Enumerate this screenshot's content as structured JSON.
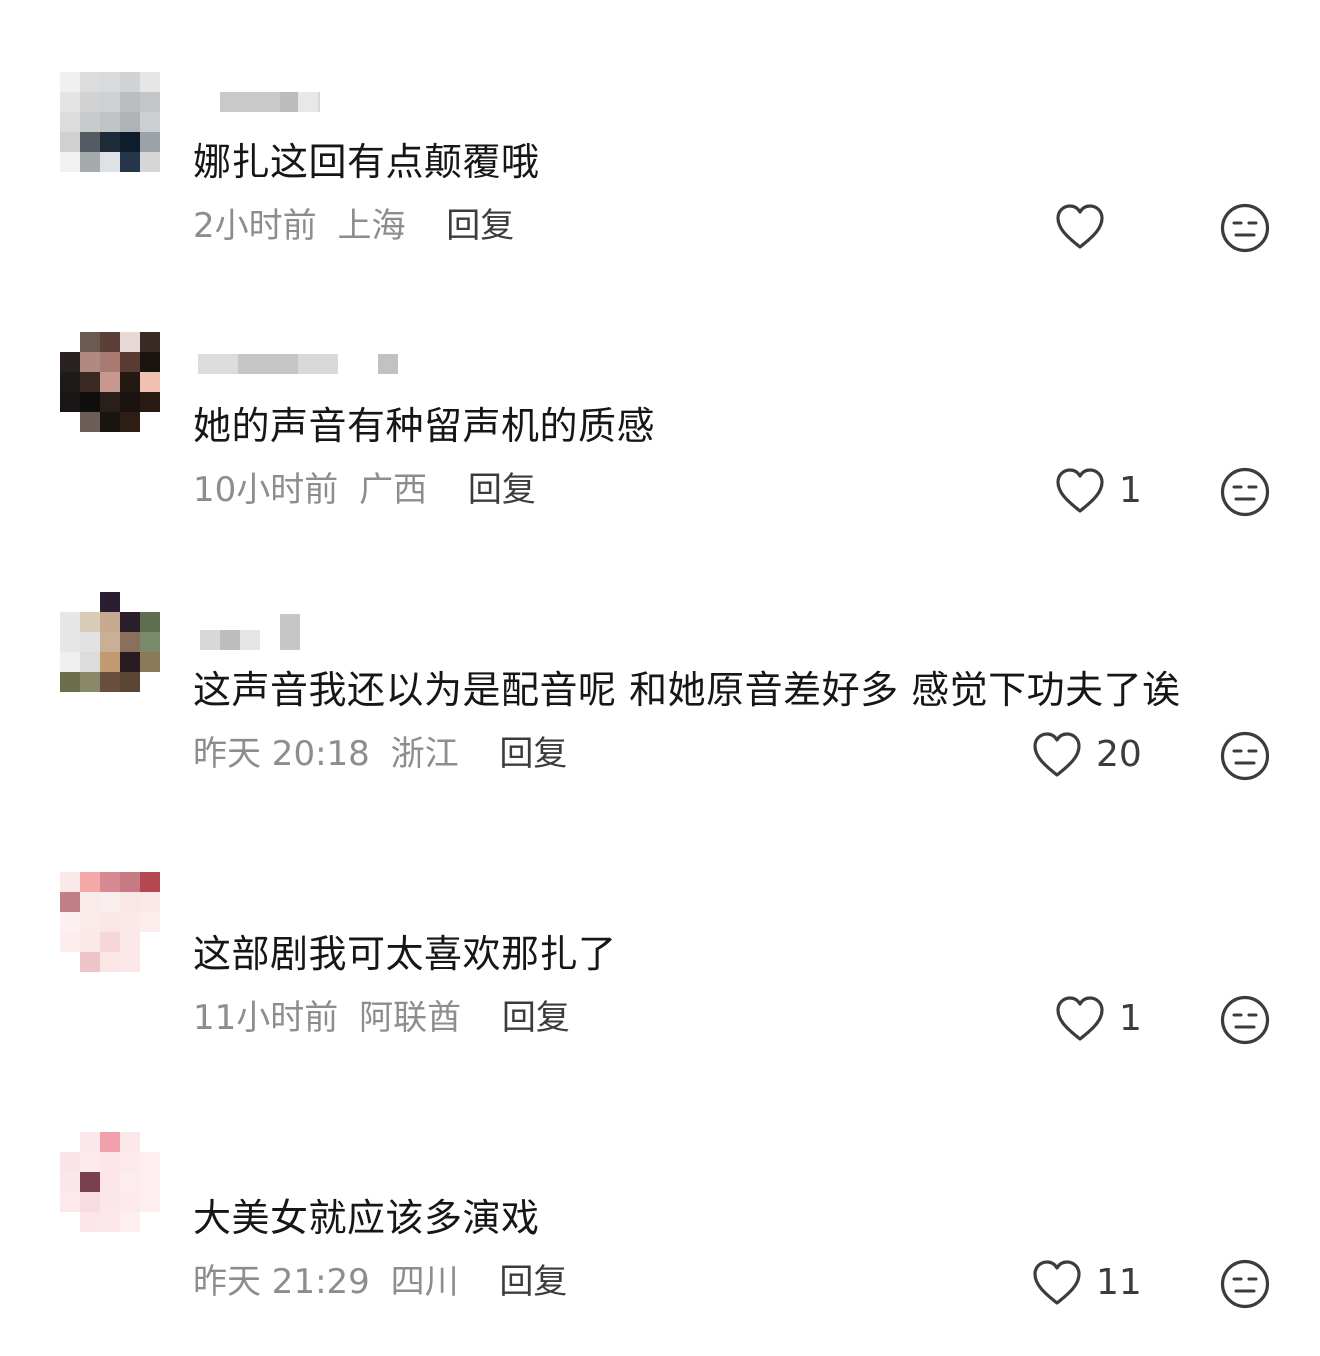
{
  "comments": [
    {
      "text": "娜扎这回有点颠覆哦",
      "time": "2小时前",
      "region": "上海",
      "reply": "回复",
      "likes": "",
      "avatar_pixels": [
        "#f0f0f0",
        "#dcdcdc",
        "#d8dadb",
        "#cfd3d4",
        "#e6e6e6",
        "#e4e4e4",
        "#d2d2d2",
        "#cdd1d3",
        "#b9bec1",
        "#c3c7c8",
        "#dcdcdc",
        "#c7c9ca",
        "#bfc3c6",
        "#aeb3b7",
        "#cbcfd2",
        "#cfd1d1",
        "#555b63",
        "#1d2a38",
        "#0f1c2c",
        "#9ca3a8",
        "#f1f1f1",
        "#a7aaad",
        "#dfe2e4",
        "#25354a",
        "#d4d6d8"
      ]
    },
    {
      "text": "她的声音有种留声机的质感",
      "time": "10小时前",
      "region": "广西",
      "reply": "回复",
      "likes": "1",
      "avatar_pixels": [
        "#ffffff",
        "#6a5a52",
        "#5a4036",
        "#e6d8d4",
        "#3a2a24",
        "#2a2220",
        "#b08a80",
        "#a87a72",
        "#5a3a32",
        "#1a1410",
        "#1e1a18",
        "#3a2a22",
        "#c89890",
        "#241812",
        "#f0c0b0",
        "#1a1616",
        "#100e0c",
        "#2a1e18",
        "#1a1410",
        "#2a1a14",
        "#ffffff",
        "#6a5e56",
        "#1a1410",
        "#2e1e16",
        "#ffffff"
      ]
    },
    {
      "text": "这声音我还以为是配音呢 和她原音差好多 感觉下功夫了诶",
      "time": "昨天 20:18",
      "region": "浙江",
      "reply": "回复",
      "likes": "20",
      "avatar_pixels": [
        "#ffffff",
        "#ffffff",
        "#2a1e30",
        "#ffffff",
        "#ffffff",
        "#e6e6e6",
        "#d6ccb8",
        "#c8aa90",
        "#2a1e2a",
        "#5e6e4e",
        "#e6e6e6",
        "#e2e2e2",
        "#c8b098",
        "#8a6e5e",
        "#7a8a6a",
        "#f0f0f0",
        "#dcdcdc",
        "#c29a72",
        "#2a1a22",
        "#8a7a5a",
        "#6a6e4a",
        "#8a8a6a",
        "#6a4e3e",
        "#5a4434",
        "#ffffff"
      ]
    },
    {
      "text": "这部剧我可太喜欢那扎了",
      "time": "11小时前",
      "region": "阿联酋",
      "reply": "回复",
      "likes": "1",
      "avatar_pixels": [
        "#fbe8e8",
        "#f4a8a8",
        "#d88a92",
        "#c87a84",
        "#b44850",
        "#c08088",
        "#fbeaea",
        "#fbeeee",
        "#fbe6e6",
        "#fce8e8",
        "#fdf0f0",
        "#fbeaea",
        "#fbe6e6",
        "#fbe8e8",
        "#fcecec",
        "#fdeeee",
        "#fbe8e8",
        "#f7d6d8",
        "#fbe8e8",
        "#ffffff",
        "#ffffff",
        "#eec4c8",
        "#fbe6e6",
        "#fce8e8",
        "#ffffff"
      ]
    },
    {
      "text": "大美女就应该多演戏",
      "time": "昨天 21:29",
      "region": "四川",
      "reply": "回复",
      "likes": "11",
      "avatar_pixels": [
        "#ffffff",
        "#fce8ec",
        "#f0a0aa",
        "#fce8ea",
        "#ffffff",
        "#fbe4e8",
        "#fdeaee",
        "#fce6ea",
        "#fde8ec",
        "#fdeef0",
        "#fbe6ea",
        "#7a4050",
        "#fde6ea",
        "#fcecef",
        "#fdeef0",
        "#fde8ec",
        "#f8dce2",
        "#fde6ea",
        "#fde8ec",
        "#fdeef0",
        "#ffffff",
        "#fde6ea",
        "#fce8ec",
        "#fdeef0",
        "#ffffff"
      ]
    }
  ],
  "icons": {
    "like": "heart-outline-icon",
    "dislike": "meh-face-icon"
  },
  "colors": {
    "text": "#161616",
    "meta": "#8d8d8d",
    "reply": "#3c3c3c",
    "icon": "#3c3c3c"
  }
}
